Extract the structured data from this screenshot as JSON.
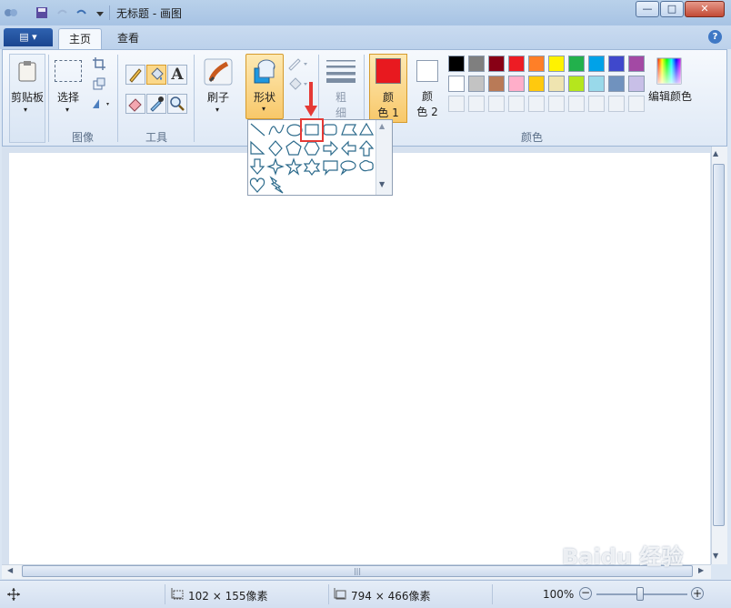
{
  "window": {
    "title": "无标题 - 画图",
    "buttons": {
      "minimize": "—",
      "maximize": "□",
      "close": "✕"
    }
  },
  "tabs": [
    {
      "label": "主页"
    },
    {
      "label": "查看"
    }
  ],
  "app_menu_label": "▤ ▾",
  "help_label": "?",
  "ribbon": {
    "clipboard": {
      "label": "剪贴板"
    },
    "image": {
      "select_label": "选择",
      "group_label": "图像"
    },
    "tools": {
      "group_label": "工具",
      "text_tool": "A"
    },
    "brushes": {
      "label": "刷子"
    },
    "shapes": {
      "label": "形状"
    },
    "size": {
      "label_line1": "粗",
      "label_line2": "细"
    },
    "color1": {
      "line1": "颜",
      "line2": "色 1",
      "value": "#e8191f"
    },
    "color2": {
      "line1": "颜",
      "line2": "色 2",
      "value": "#ffffff"
    },
    "colors_group_label": "颜色",
    "edit_colors_label": "编辑颜色",
    "palette_row1": [
      "#000000",
      "#7f7f7f",
      "#880015",
      "#ed1c24",
      "#ff7f27",
      "#fff200",
      "#22b14c",
      "#00a2e8",
      "#3f48cc",
      "#a349a4"
    ],
    "palette_row2": [
      "#ffffff",
      "#c3c3c3",
      "#b97a57",
      "#ffaec9",
      "#ffc90e",
      "#efe4b0",
      "#b5e61d",
      "#99d9ea",
      "#7092be",
      "#c8bfe7"
    ]
  },
  "status": {
    "selection_size": "102 × 155像素",
    "canvas_size": "794 × 466像素",
    "zoom": "100%"
  },
  "watermark": "Baidu 经验"
}
